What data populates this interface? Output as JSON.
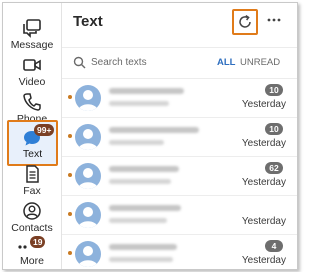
{
  "nav": {
    "items": [
      {
        "label": "Message",
        "icon": "message-icon"
      },
      {
        "label": "Video",
        "icon": "video-icon"
      },
      {
        "label": "Phone",
        "icon": "phone-icon"
      },
      {
        "label": "Text",
        "icon": "text-bubble-icon",
        "badge": "99+",
        "active": true
      },
      {
        "label": "Fax",
        "icon": "fax-icon"
      },
      {
        "label": "Contacts",
        "icon": "contacts-icon"
      },
      {
        "label": "More",
        "icon": "more-dots-icon",
        "badge": "19"
      }
    ]
  },
  "header": {
    "title": "Text"
  },
  "search": {
    "placeholder": "Search texts"
  },
  "filters": {
    "all": "ALL",
    "unread": "UNREAD"
  },
  "conversations": [
    {
      "count": "10",
      "time": "Yesterday",
      "unread": true
    },
    {
      "count": "10",
      "time": "Yesterday",
      "unread": true
    },
    {
      "count": "62",
      "time": "Yesterday",
      "unread": true
    },
    {
      "count": "",
      "time": "Yesterday",
      "unread": true
    },
    {
      "count": "4",
      "time": "Yesterday",
      "unread": true
    }
  ],
  "colors": {
    "accent_highlight": "#e07b1a",
    "link_blue": "#2f6fbf",
    "badge_brown": "#7a3f24",
    "unread_dot": "#c97a22",
    "avatar_blue": "#8db2dc"
  }
}
